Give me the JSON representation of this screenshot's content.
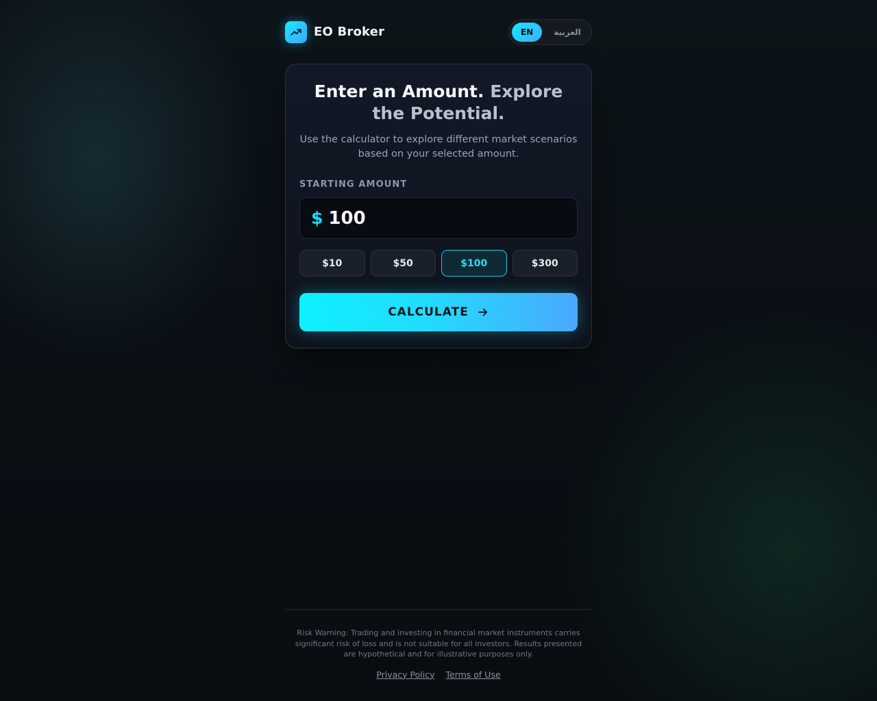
{
  "brand": {
    "name": "EO Broker",
    "logo_icon": "trending-up-icon"
  },
  "language": {
    "en_label": "EN",
    "ar_label": "العربية",
    "active": "EN"
  },
  "hero": {
    "title_main": "Enter an Amount.",
    "title_accent": "Explore the Potential.",
    "subtitle": "Use the calculator to explore different market scenarios based on your selected amount."
  },
  "form": {
    "label": "STARTING AMOUNT",
    "currency_symbol": "$",
    "amount_value": "100",
    "presets": [
      "$10",
      "$50",
      "$100",
      "$300"
    ],
    "active_preset": "$100",
    "calculate_label": "CALCULATE",
    "calculate_icon": "arrow-right-icon"
  },
  "footer": {
    "risk_warning": "Risk Warning: Trading and investing in financial market instruments carries significant risk of loss and is not suitable for all investors. Results presented are hypothetical and for illustrative purposes only.",
    "privacy_label": "Privacy Policy",
    "terms_label": "Terms of Use"
  },
  "colors": {
    "accent": "#19d8f3",
    "accent_end": "#4aa8ff",
    "background": "#0a0f14"
  }
}
